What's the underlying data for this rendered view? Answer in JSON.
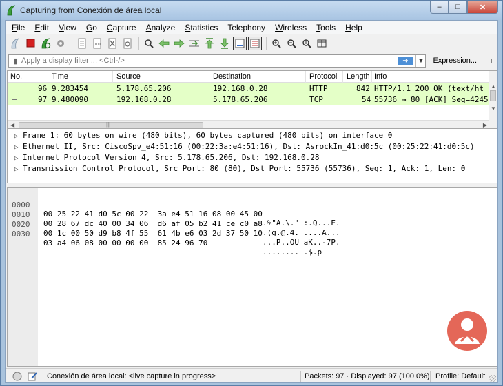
{
  "window": {
    "title": "Capturing from Conexión de área local"
  },
  "menu": [
    {
      "label": "File",
      "ul": "F",
      "rest": "ile"
    },
    {
      "label": "Edit",
      "ul": "E",
      "rest": "dit"
    },
    {
      "label": "View",
      "ul": "V",
      "rest": "iew"
    },
    {
      "label": "Go",
      "ul": "G",
      "rest": "o"
    },
    {
      "label": "Capture",
      "ul": "C",
      "rest": "apture"
    },
    {
      "label": "Analyze",
      "ul": "A",
      "rest": "nalyze"
    },
    {
      "label": "Statistics",
      "ul": "S",
      "rest": "tatistics"
    },
    {
      "label": "Telephony",
      "ul": "",
      "rest": "Telephony"
    },
    {
      "label": "Wireless",
      "ul": "W",
      "rest": "ireless"
    },
    {
      "label": "Tools",
      "ul": "T",
      "rest": "ools"
    },
    {
      "label": "Help",
      "ul": "H",
      "rest": "elp"
    }
  ],
  "filter": {
    "placeholder": "Apply a display filter ... <Ctrl-/>",
    "expression_label": "Expression...",
    "plus_label": "+"
  },
  "packet_list": {
    "columns": [
      "No.",
      "Time",
      "Source",
      "Destination",
      "Protocol",
      "Length",
      "Info"
    ],
    "rows": [
      {
        "no": "96",
        "time": "9.283454",
        "source": "5.178.65.206",
        "destination": "192.168.0.28",
        "protocol": "HTTP",
        "length": "842",
        "info": "HTTP/1.1 200 OK  (text/ht"
      },
      {
        "no": "97",
        "time": "9.480090",
        "source": "192.168.0.28",
        "destination": "5.178.65.206",
        "protocol": "TCP",
        "length": "54",
        "info": "55736 → 80 [ACK] Seq=4245"
      }
    ],
    "row_color": "#e4ffc7"
  },
  "details": [
    "Frame 1: 60 bytes on wire (480 bits), 60 bytes captured (480 bits) on interface 0",
    "Ethernet II, Src: CiscoSpv_e4:51:16 (00:22:3a:e4:51:16), Dst: AsrockIn_41:d0:5c (00:25:22:41:d0:5c)",
    "Internet Protocol Version 4, Src: 5.178.65.206, Dst: 192.168.0.28",
    "Transmission Control Protocol, Src Port: 80 (80), Dst Port: 55736 (55736), Seq: 1, Ack: 1, Len: 0"
  ],
  "hex": [
    {
      "offset": "0000",
      "bytes": "00 25 22 41 d0 5c 00 22  3a e4 51 16 08 00 45 00",
      "ascii": ".%\"A.\\.\" :.Q...E."
    },
    {
      "offset": "0010",
      "bytes": "00 28 67 dc 40 00 34 06  d6 af 05 b2 41 ce c0 a8",
      "ascii": ".(g.@.4. ....A..."
    },
    {
      "offset": "0020",
      "bytes": "00 1c 00 50 d9 b8 4f 55  61 4b e6 03 2d 37 50 10",
      "ascii": "...P..OU aK..-7P."
    },
    {
      "offset": "0030",
      "bytes": "03 a4 06 08 00 00 00 00  85 24 96 70",
      "ascii": "........ .$.p"
    }
  ],
  "status": {
    "interface": "Conexión de área local: <live capture in progress>",
    "packets": "Packets: 97 · Displayed: 97 (100.0%)",
    "profile": "Profile: Default"
  },
  "colors": {
    "row_highlight": "#e4ffc7",
    "apply_arrow": "#4d8fd6",
    "stop_red": "#d42020",
    "shark_fin": "#2f7bd1"
  }
}
